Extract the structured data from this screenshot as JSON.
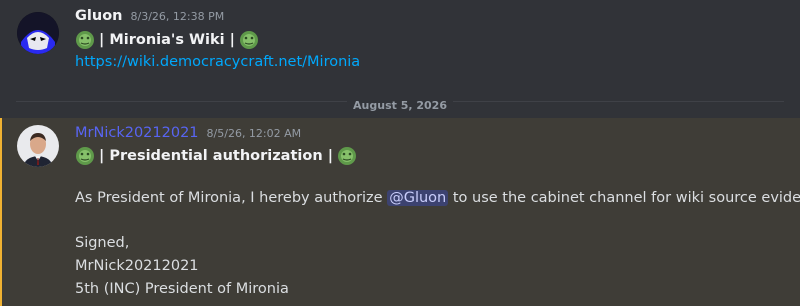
{
  "messages": [
    {
      "author": "Gluon",
      "timestamp": "8/3/26, 12:38 PM",
      "title_prefix": "| Mironia's Wiki |",
      "link": "https://wiki.democracycraft.net/Mironia",
      "author_color": "#f2f3f5"
    },
    {
      "author": "MrNick20212021",
      "timestamp": "8/5/26, 12:02 AM",
      "title_prefix": "| Presidential authorization |",
      "body_before": "As President of Mironia, I hereby authorize ",
      "mention": "@Gluon",
      "body_after": " to use the cabinet channel for wiki source evidence.",
      "signed": "Signed,",
      "sign_name": "MrNick20212021",
      "sign_title": "5th (INC) President of Mironia",
      "author_color": "#5865f2",
      "highlight_color": "#f0b232"
    }
  ],
  "date_divider": "August 5, 2026",
  "emoji_icon": "frog-emoji-icon"
}
